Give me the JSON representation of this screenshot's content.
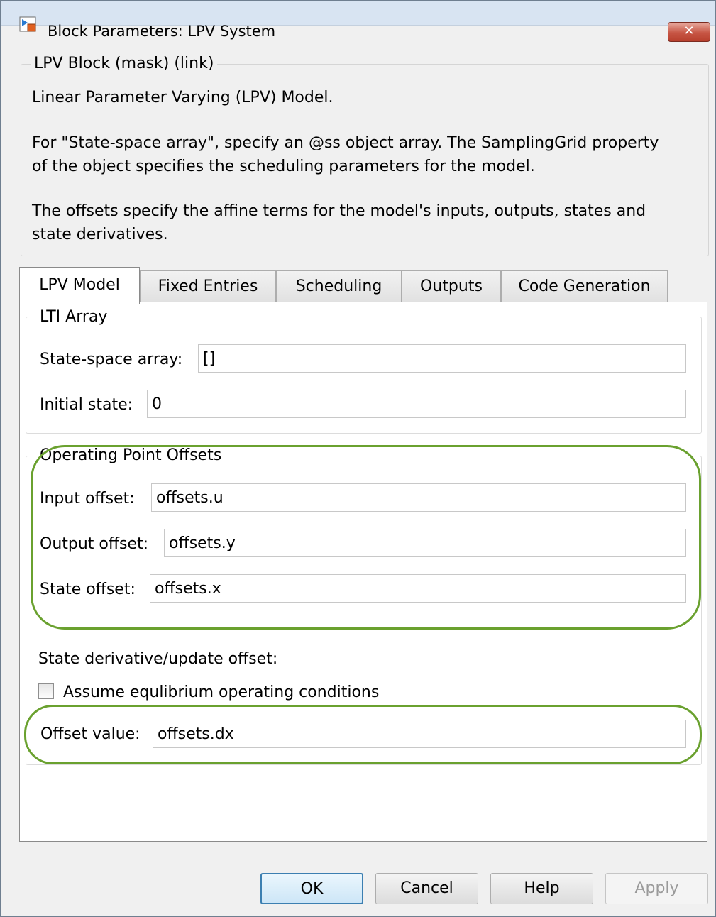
{
  "window": {
    "title": "Block Parameters: LPV System",
    "close_label": "✕"
  },
  "description": {
    "legend": "LPV Block (mask) (link)",
    "lines": [
      "Linear Parameter Varying (LPV) Model.",
      "For \"State-space array\", specify an @ss object array. The SamplingGrid property",
      "of the object specifies the scheduling parameters for the model.",
      "The offsets specify the affine terms for the model's inputs, outputs, states and",
      "state derivatives."
    ]
  },
  "tabs": [
    "LPV Model",
    "Fixed Entries",
    "Scheduling",
    "Outputs",
    "Code Generation"
  ],
  "lti_array": {
    "legend": "LTI Array",
    "state_space_label": "State-space array:",
    "state_space_value": "[]",
    "initial_state_label": "Initial state:",
    "initial_state_value": "0"
  },
  "offsets": {
    "legend": "Operating Point Offsets",
    "input_label": "Input offset:",
    "input_value": "offsets.u",
    "output_label": "Output offset:",
    "output_value": "offsets.y",
    "state_label": "State offset:",
    "state_value": "offsets.x",
    "derivative_heading": "State derivative/update offset:",
    "equilibrium_label": "Assume equlibrium operating conditions",
    "equilibrium_checked": false,
    "offset_value_label": "Offset value:",
    "offset_value": "offsets.dx"
  },
  "buttons": {
    "ok": "OK",
    "cancel": "Cancel",
    "help": "Help",
    "apply": "Apply"
  },
  "colors": {
    "highlight": "#6aa12f",
    "default_button_border": "#3c7fb1"
  }
}
